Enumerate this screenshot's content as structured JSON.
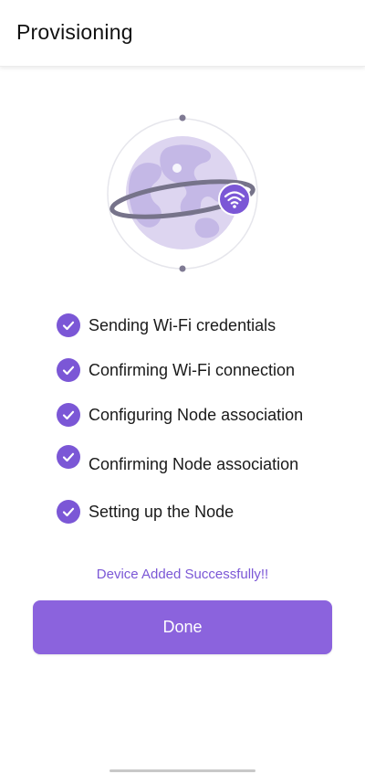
{
  "app_bar": {
    "title": "Provisioning"
  },
  "illustration": {
    "icon": "globe-wifi-icon"
  },
  "steps": [
    {
      "label": "Sending Wi-Fi credentials",
      "status": "done"
    },
    {
      "label": "Confirming Wi-Fi connection",
      "status": "done"
    },
    {
      "label": "Configuring Node association",
      "status": "done"
    },
    {
      "label": "Confirming Node association",
      "status": "done"
    },
    {
      "label": "Setting up the Node",
      "status": "done"
    }
  ],
  "status_message": "Device Added Successfully!!",
  "done_button": {
    "label": "Done"
  },
  "colors": {
    "accent": "#7b57d6",
    "button": "#8b63dd",
    "globe_light": "#ddd5f0",
    "globe_dark": "#c4b8e6"
  }
}
